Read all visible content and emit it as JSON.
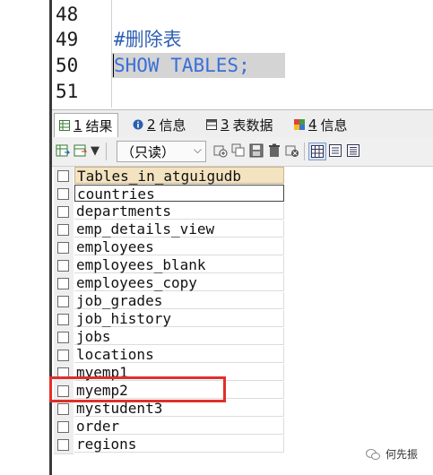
{
  "editor": {
    "lines": [
      {
        "num": "48",
        "text": ""
      },
      {
        "num": "49",
        "text": "#删除表"
      },
      {
        "num": "50",
        "text": "SHOW TABLES;"
      },
      {
        "num": "51",
        "text": ""
      }
    ]
  },
  "tabs": [
    {
      "icon": "grid-icon",
      "num": "1",
      "label": "结果"
    },
    {
      "icon": "info-icon",
      "num": "2",
      "label": "信息"
    },
    {
      "icon": "table-icon",
      "num": "3",
      "label": "表数据"
    },
    {
      "icon": "info-colored-icon",
      "num": "4",
      "label": "信息"
    }
  ],
  "toolbar": {
    "mode_select": "（只读）"
  },
  "results": {
    "header": "Tables_in_atguigudb",
    "rows": [
      "countries",
      "departments",
      "emp_details_view",
      "employees",
      "employees_blank",
      "employees_copy",
      "job_grades",
      "job_history",
      "jobs",
      "locations",
      "myemp1",
      "myemp2",
      "mystudent3",
      "order",
      "regions"
    ],
    "highlighted_row": "myemp2"
  },
  "watermark": {
    "text": "何先振"
  },
  "colors": {
    "comment": "#2f5fb3",
    "keyword": "#3b6fd8",
    "header_bg": "#f3e3c1",
    "highlight_box": "#e0302c"
  }
}
